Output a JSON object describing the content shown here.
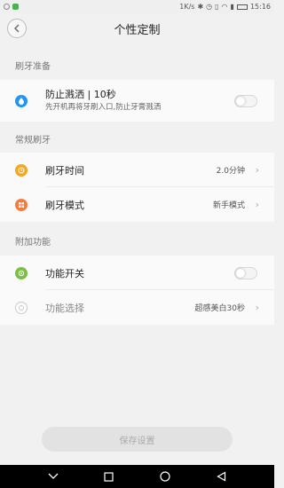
{
  "status_bar": {
    "speed": "1K/s",
    "time": "15:16"
  },
  "header": {
    "title": "个性定制"
  },
  "sections": [
    {
      "title": "刷牙准备"
    },
    {
      "title": "常规刷牙"
    },
    {
      "title": "附加功能"
    }
  ],
  "rows": {
    "anti_splash": {
      "label": "防止溅洒 | 10秒",
      "sublabel": "先开机再将牙刷入口,防止牙膏溅洒",
      "enabled": false,
      "icon": "water-drop-icon",
      "icon_color": "#2196f3"
    },
    "brush_time": {
      "label": "刷牙时间",
      "value": "2.0分钟",
      "icon": "clock-icon",
      "icon_color": "#f5a623"
    },
    "brush_mode": {
      "label": "刷牙模式",
      "value": "新手模式",
      "icon": "grid-icon",
      "icon_color": "#f57c3f"
    },
    "feature_switch": {
      "label": "功能开关",
      "enabled": false,
      "icon": "power-ring-icon",
      "icon_color": "#7bc043"
    },
    "feature_select": {
      "label": "功能选择",
      "value": "超感美白30秒",
      "icon": "gear-icon",
      "icon_color": "#c8c8c8"
    }
  },
  "footer": {
    "save_label": "保存设置"
  }
}
